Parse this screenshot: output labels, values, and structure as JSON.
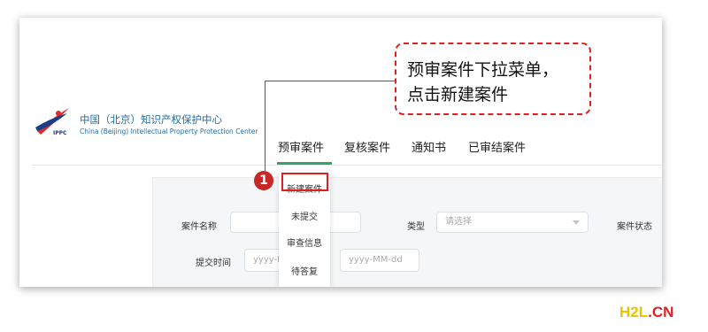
{
  "org": {
    "name_cn": "中国（北京）知识产权保护中心",
    "name_en": "China (Beijing) Intellectual Property Protection Center",
    "logo_text": "IPPC"
  },
  "nav": {
    "items": [
      {
        "label": "预审案件",
        "active": true
      },
      {
        "label": "复核案件",
        "active": false
      },
      {
        "label": "通知书",
        "active": false
      },
      {
        "label": "已审结案件",
        "active": false
      }
    ],
    "accent_color": "#37a36b"
  },
  "dropdown": {
    "items": [
      "新建案件",
      "未提交",
      "审查信息",
      "待答复"
    ],
    "highlighted_index": 0
  },
  "filter": {
    "case_name_label": "案件名称",
    "case_name_value": "",
    "type_label": "类型",
    "type_placeholder": "请选择",
    "status_label": "案件状态",
    "submit_time_label": "提交时间",
    "date_start_placeholder": "yyyy-M",
    "date_end_placeholder": "yyyy-MM-dd"
  },
  "annotation": {
    "step_number": "1",
    "callout_line1": "预审案件下拉菜单，",
    "callout_line2": "点击新建案件",
    "color": "#e02020"
  },
  "watermark": {
    "part1": "H2L",
    "part2": ".CN"
  }
}
